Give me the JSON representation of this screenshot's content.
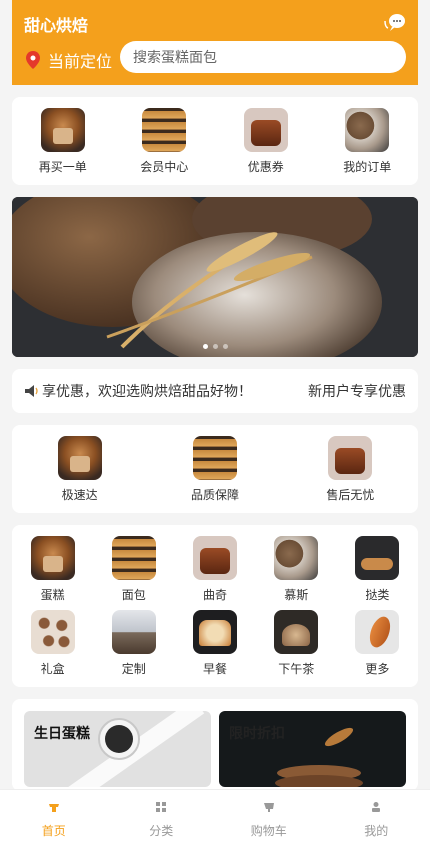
{
  "header": {
    "app_title": "甜心烘焙",
    "location_label": "当前定位",
    "search_placeholder": "搜索蛋糕面包",
    "accent_color": "#f4a01c"
  },
  "quick_actions": [
    {
      "label": "再买一单",
      "icon": "cupcake-photo"
    },
    {
      "label": "会员中心",
      "icon": "bakery-shelf-photo"
    },
    {
      "label": "优惠券",
      "icon": "chocolate-cake-photo"
    },
    {
      "label": "我的订单",
      "icon": "seeded-bread-photo"
    }
  ],
  "banner": {
    "icon": "bread-and-wheat-photo",
    "slides": 3,
    "active_slide": 1
  },
  "notice": {
    "message": "享优惠，欢迎选购烘焙甜品好物！",
    "promo_label": "新用户专享优惠"
  },
  "services": [
    {
      "label": "极速达",
      "icon": "cupcake-photo"
    },
    {
      "label": "品质保障",
      "icon": "bakery-shelf-photo"
    },
    {
      "label": "售后无忧",
      "icon": "chocolate-cake-photo"
    }
  ],
  "categories": [
    {
      "label": "蛋糕",
      "icon": "cupcake-photo"
    },
    {
      "label": "面包",
      "icon": "bakery-shelf-photo"
    },
    {
      "label": "曲奇",
      "icon": "chocolate-cake-photo"
    },
    {
      "label": "慕斯",
      "icon": "seeded-bread-photo"
    },
    {
      "label": "挞类",
      "icon": "bread-loaves-photo"
    },
    {
      "label": "礼盒",
      "icon": "cookies-photo"
    },
    {
      "label": "定制",
      "icon": "pastry-display-photo"
    },
    {
      "label": "早餐",
      "icon": "toast-photo"
    },
    {
      "label": "下午茶",
      "icon": "bread-basket-photo"
    },
    {
      "label": "更多",
      "icon": "croissant-photo"
    }
  ],
  "promos": [
    {
      "title": "生日蛋糕",
      "icon": "smartwatch-photo"
    },
    {
      "title": "限时折扣",
      "icon": "pancakes-photo"
    }
  ],
  "tabbar": [
    {
      "label": "首页",
      "icon": "home-icon",
      "active": true
    },
    {
      "label": "分类",
      "icon": "grid-icon",
      "active": false
    },
    {
      "label": "购物车",
      "icon": "cart-icon",
      "active": false
    },
    {
      "label": "我的",
      "icon": "user-icon",
      "active": false
    }
  ]
}
